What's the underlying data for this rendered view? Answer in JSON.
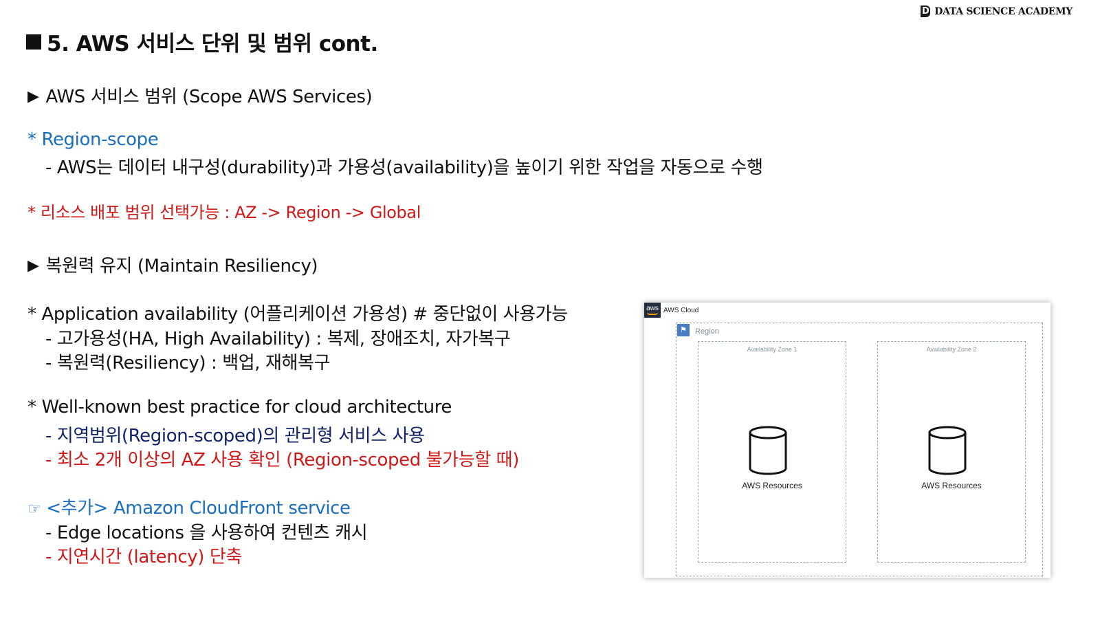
{
  "brand": {
    "logo_letter": "D",
    "name": "DATA SCIENCE ACADEMY"
  },
  "title": "5. AWS 서비스 단위 및 범위  cont.",
  "scope": {
    "header": "AWS 서비스 범위 (Scope AWS Services)",
    "region_scope": "* Region-scope",
    "region_desc": "- AWS는 데이터 내구성(durability)과 가용성(availability)을 높이기 위한 작업을 자동으로 수행",
    "deploy_note": "* 리소스 배포 범위 선택가능 : AZ -> Region -> Global"
  },
  "resiliency": {
    "header": "복원력 유지 (Maintain Resiliency)",
    "app_avail": "* Application availability (어플리케이션 가용성) # 중단없이 사용가능",
    "ha": "- 고가용성(HA, High Availability) : 복제, 장애조치, 자가복구",
    "res": "- 복원력(Resiliency) : 백업, 재해복구",
    "best_practice": "* Well-known best practice for cloud architecture",
    "bp_item1": "- 지역범위(Region-scoped)의 관리형 서비스 사용",
    "bp_item2": "- 최소 2개 이상의 AZ 사용 확인 (Region-scoped 불가능할 때)"
  },
  "extra": {
    "header": "<추가> Amazon CloudFront service",
    "item1": "- Edge locations 을 사용하여 컨텐츠 캐시",
    "item2": "- 지연시간 (latency) 단축"
  },
  "diagram": {
    "logo_text": "aws",
    "cloud_label": "AWS Cloud",
    "region_label": "Region",
    "zones": [
      {
        "label": "Availability Zone 1",
        "resource": "AWS Resources"
      },
      {
        "label": "Availability Zone 2",
        "resource": "AWS Resources"
      }
    ]
  },
  "colors": {
    "blue": "#1a6fc0",
    "red": "#d01818",
    "navy": "#10246b"
  },
  "icons": [
    "square-bullet-icon",
    "triangle-arrow-icon",
    "pointing-hand-icon",
    "aws-logo-icon",
    "region-flag-icon",
    "database-cylinder-icon"
  ]
}
